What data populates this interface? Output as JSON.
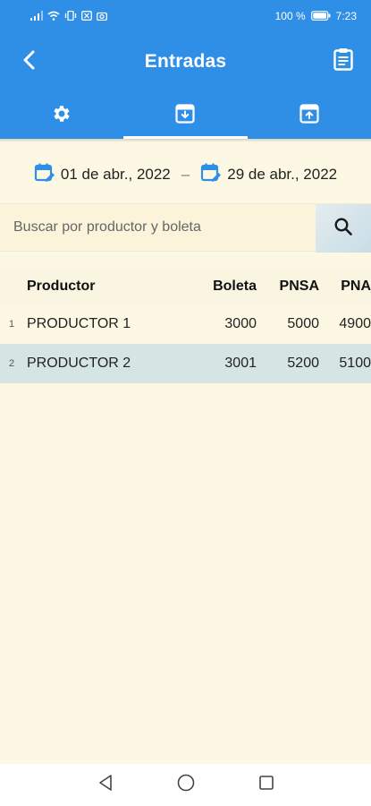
{
  "status_bar": {
    "battery": "100 %",
    "time": "7:23"
  },
  "app_bar": {
    "title": "Entradas",
    "back_icon": "back-icon",
    "action_icon": "clipboard-icon"
  },
  "tabs": [
    {
      "icon": "gear-icon",
      "active": false
    },
    {
      "icon": "archive-in-icon",
      "active": true
    },
    {
      "icon": "archive-out-icon",
      "active": false
    }
  ],
  "date_range": {
    "start": "01 de abr., 2022",
    "separator": "–",
    "end": "29 de abr., 2022"
  },
  "search": {
    "placeholder": "Buscar por productor y boleta",
    "value": ""
  },
  "table": {
    "columns": [
      "Productor",
      "Boleta",
      "PNSA",
      "PNA"
    ],
    "rows": [
      {
        "index": "1",
        "productor": "PRODUCTOR 1",
        "boleta": "3000",
        "pnsa": "5000",
        "pna": "4900"
      },
      {
        "index": "2",
        "productor": "PRODUCTOR 2",
        "boleta": "3001",
        "pnsa": "5200",
        "pna": "5100"
      }
    ],
    "selected_row": 2
  },
  "colors": {
    "primary": "#2f8fe6",
    "background": "#fdf8e4",
    "selected_row": "#d5e5e4"
  }
}
